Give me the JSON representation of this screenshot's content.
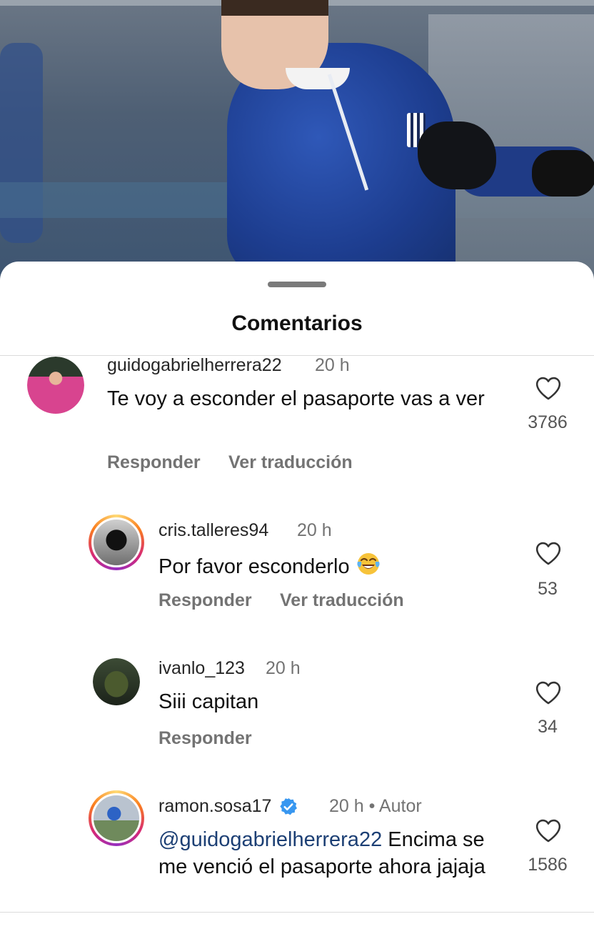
{
  "sheet": {
    "title": "Comentarios"
  },
  "comments": [
    {
      "username": "guidogabrielherrera22",
      "time": "20 h",
      "text": "Te voy a esconder el pasaporte vas a ver",
      "likes": "3786",
      "actions": [
        "Responder",
        "Ver traducción"
      ]
    },
    {
      "username": "cris.talleres94",
      "time": "20 h",
      "text": "Por favor esconderlo",
      "emoji": "face-with-tears-of-joy",
      "likes": "53",
      "actions": [
        "Responder",
        "Ver traducción"
      ]
    },
    {
      "username": "ivanlo_123",
      "time": "20 h",
      "text": "Siii capitan",
      "likes": "34",
      "actions": [
        "Responder"
      ]
    },
    {
      "username": "ramon.sosa17",
      "verified": true,
      "time": "20 h • Autor",
      "mention": "@guidogabrielherrera22",
      "text": " Encima se me venció el pasaporte ahora jajaja",
      "likes": "1586"
    }
  ],
  "icons": {
    "like": "heart-outline-icon",
    "verified": "verified-badge-icon"
  },
  "colors": {
    "mention": "#1c3f74",
    "muted": "#737373",
    "verified": "#3897f0"
  }
}
